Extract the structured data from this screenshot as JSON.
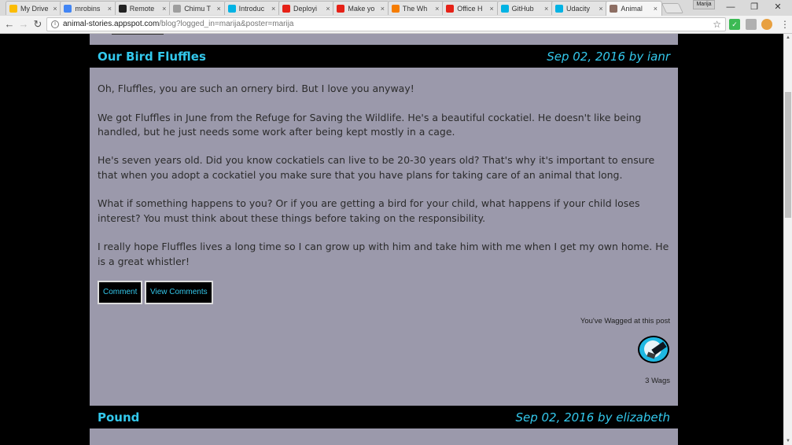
{
  "browser": {
    "tabs": [
      {
        "label": "My Drive",
        "icon": "drive-icon",
        "color": "#fbbc04"
      },
      {
        "label": "mrobins",
        "icon": "doc-icon",
        "color": "#4285f4"
      },
      {
        "label": "Remote",
        "icon": "remote-icon",
        "color": "#222222"
      },
      {
        "label": "Chimu T",
        "icon": "page-icon",
        "color": "#9e9e9e"
      },
      {
        "label": "Introduc",
        "icon": "udacity-icon",
        "color": "#02b3e4"
      },
      {
        "label": "Deployi",
        "icon": "youtube-icon",
        "color": "#e62117"
      },
      {
        "label": "Make yo",
        "icon": "youtube-icon",
        "color": "#e62117"
      },
      {
        "label": "The Wh",
        "icon": "orange-icon",
        "color": "#f57c00"
      },
      {
        "label": "Office H",
        "icon": "youtube-icon",
        "color": "#e62117"
      },
      {
        "label": "GitHub",
        "icon": "udacity-icon",
        "color": "#02b3e4"
      },
      {
        "label": "Udacity",
        "icon": "udacity-icon",
        "color": "#02b3e4"
      },
      {
        "label": "Animal",
        "icon": "animal-icon",
        "color": "#8d6e63"
      }
    ],
    "tab_close": "×",
    "user": "Marija",
    "url_host": "animal-stories.appspot.com",
    "url_path": "/blog?logged_in=marija&poster=marija"
  },
  "posts": [
    {
      "title": "Our Bird Fluffles",
      "meta": "Sep 02, 2016 by ianr",
      "paragraphs": [
        "Oh, Fluffles, you are such an ornery bird. But I love you anyway!",
        "We got Fluffles in June from the Refuge for Saving the Wildlife. He's a beautiful cockatiel. He doesn't like being handled, but he just needs some work after being kept mostly in a cage.",
        "He's seven years old. Did you know cockatiels can live to be 20-30 years old? That's why it's important to ensure that when you adopt a cockatiel you make sure that you have plans for taking care of an animal that long.",
        "What if something happens to you? Or if you are getting a bird for your child, what happens if your child loses interest? You must think about these things before taking on the responsibility.",
        "I really hope Fluffles lives a long time so I can grow up with him and take him with me when I get my own home. He is a great whistler!"
      ],
      "comment_label": "Comment",
      "view_comments_label": "View Comments",
      "wagged_note": "You've Wagged at this post",
      "wag_count": "3 Wags"
    },
    {
      "title": "Pound",
      "meta": "Sep 02, 2016 by elizabeth"
    }
  ],
  "colors": {
    "accent": "#33c8ec",
    "panel": "#9b99ab",
    "header_bg": "#000000"
  }
}
